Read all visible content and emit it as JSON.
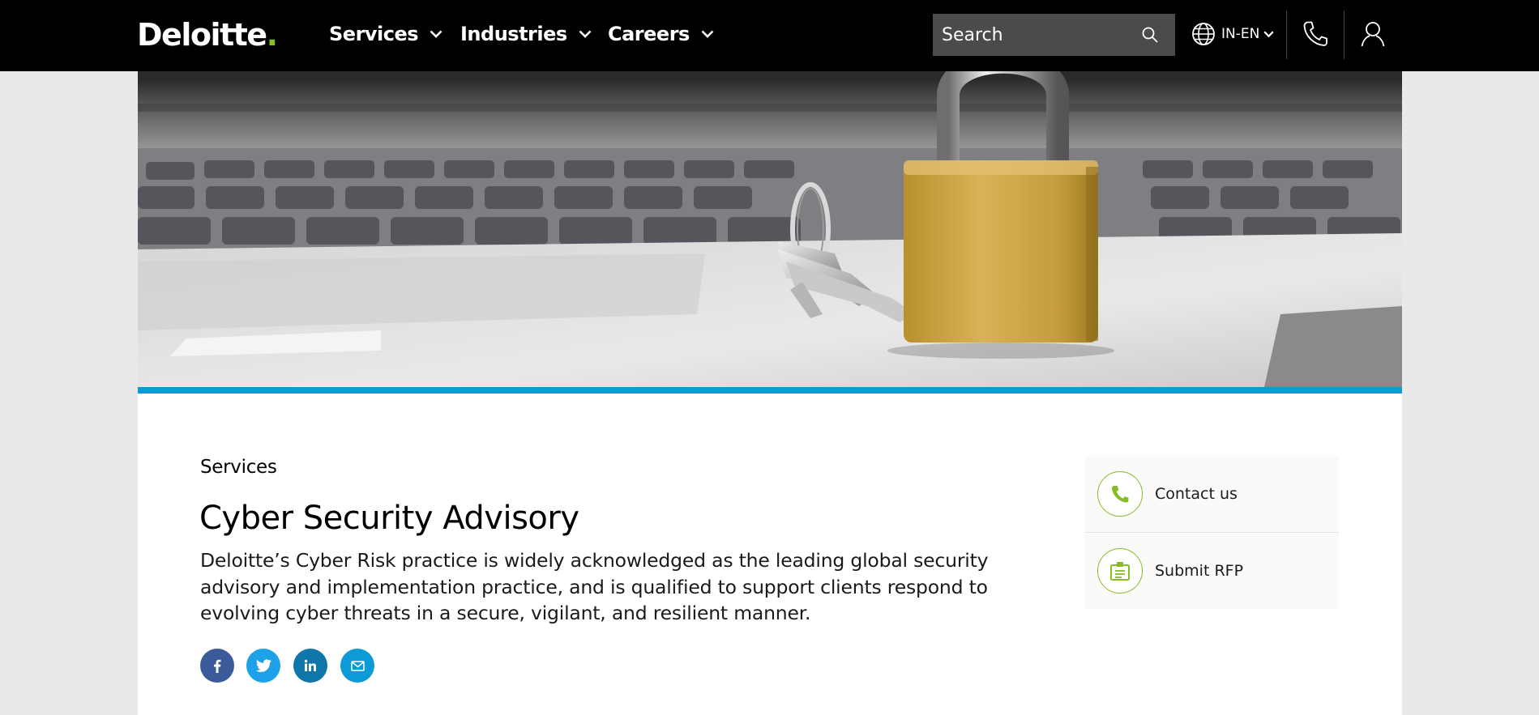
{
  "header": {
    "logo": "Deloitte",
    "logo_dot": ".",
    "nav": [
      {
        "label": "Services"
      },
      {
        "label": "Industries"
      },
      {
        "label": "Careers"
      }
    ],
    "search": {
      "placeholder": "Search",
      "value": ""
    },
    "language": "IN-EN",
    "icons": [
      "globe-icon",
      "phone-icon",
      "user-icon",
      "search-icon"
    ]
  },
  "hero": {
    "image": "padlock-and-keys-on-laptop",
    "accent_color": "#0e9ad8"
  },
  "main": {
    "eyebrow": "Services",
    "title": "Cyber Security Advisory",
    "description": "Deloitte’s Cyber Risk practice is widely acknowledged as the leading global security advisory and implementation practice, and is qualified to support clients respond to evolving cyber threats in a secure, vigilant, and resilient manner.",
    "share": [
      {
        "network": "facebook",
        "icon": "facebook-icon",
        "color": "#3b5a9a"
      },
      {
        "network": "twitter",
        "icon": "twitter-icon",
        "color": "#1da1e8"
      },
      {
        "network": "linkedin",
        "icon": "linkedin-icon",
        "color": "#0e76a8"
      },
      {
        "network": "email",
        "icon": "email-icon",
        "color": "#0d9bd8"
      }
    ]
  },
  "sidebar": {
    "items": [
      {
        "label": "Contact us",
        "icon": "phone-icon"
      },
      {
        "label": "Submit RFP",
        "icon": "document-icon"
      }
    ],
    "accent_color": "#86bc25"
  },
  "colors": {
    "header_bg": "#000000",
    "brand_green": "#86bc25",
    "page_bg": "#e8e9e8"
  }
}
